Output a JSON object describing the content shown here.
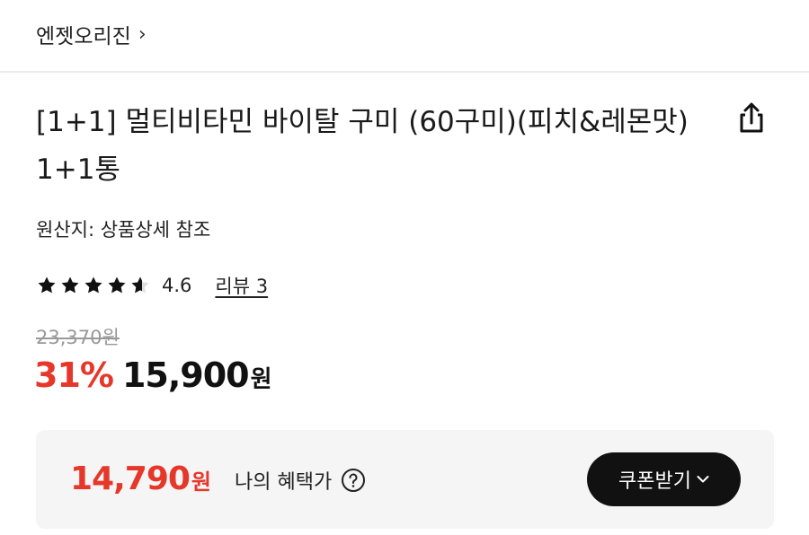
{
  "header": {
    "brand": "엔젯오리진",
    "brand_chevron": "›"
  },
  "product": {
    "title": "[1+1] 멀티비타민 바이탈 구미 (60구미)(피치&레몬맛) 1+1통",
    "origin": "원산지: 상품상세 참조",
    "rating": {
      "value": "4.6",
      "stars": 4.6,
      "review_label": "리뷰 3"
    },
    "original_price": "23,370원",
    "discount": "31%",
    "price": "15,900",
    "price_unit": "원"
  },
  "benefit": {
    "price": "14,790",
    "price_unit": "원",
    "label": "나의 혜택가",
    "coupon_button": "쿠폰받기"
  },
  "colors": {
    "accent_red": "#e5372a",
    "dark": "#111111",
    "muted": "#999999"
  },
  "icons": [
    "share-icon",
    "star-icon",
    "help-icon",
    "chevron-down-icon",
    "chevron-right-icon"
  ]
}
